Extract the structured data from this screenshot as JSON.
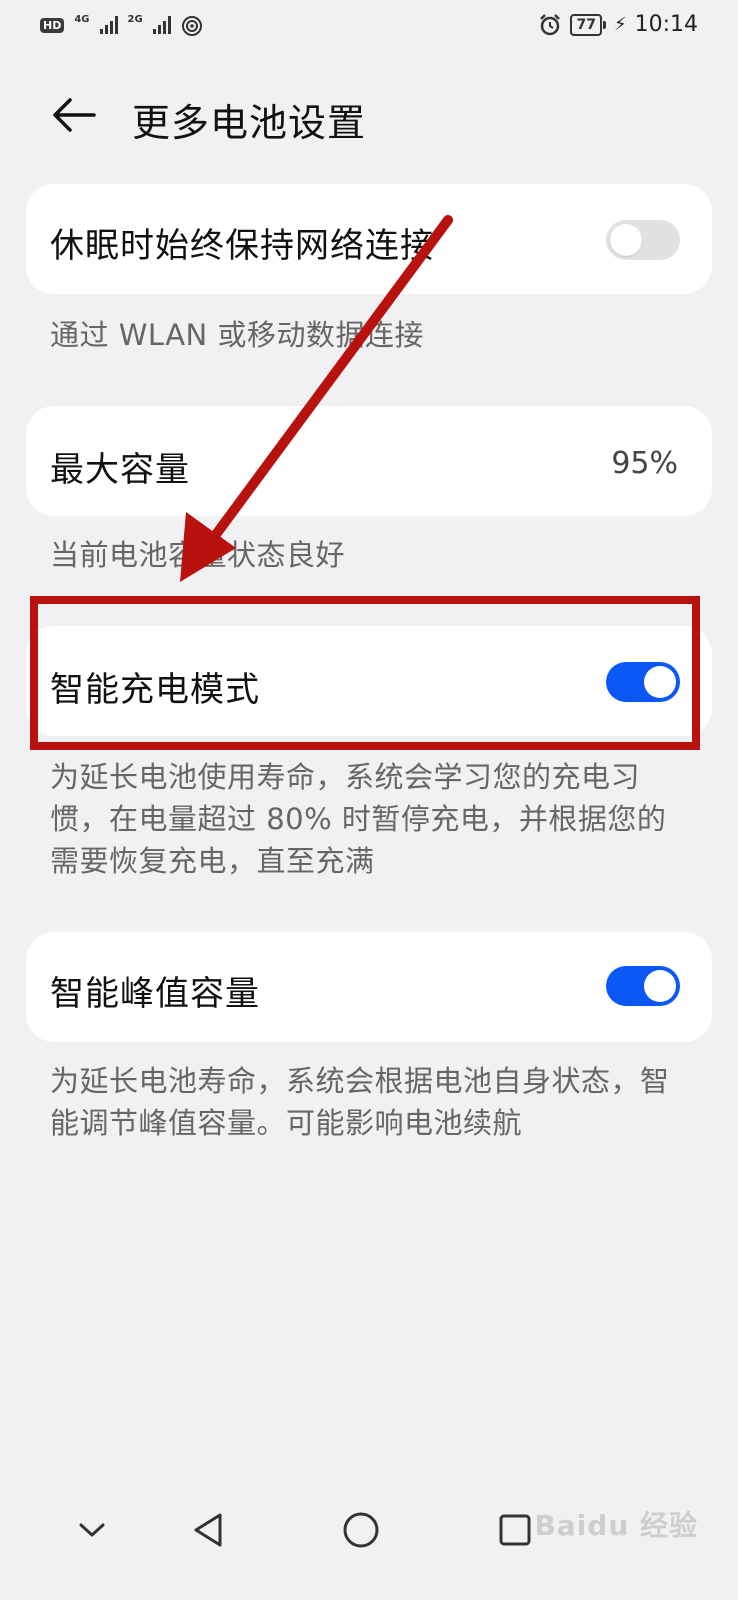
{
  "status_bar": {
    "hd": "HD",
    "sim1_network": "4G",
    "sim2_network": "2G",
    "battery_level": "77",
    "time": "10:14",
    "icons": [
      "hd-icon",
      "signal-icon",
      "wifi-icon",
      "alarm-icon",
      "battery-icon",
      "charging-icon"
    ]
  },
  "header": {
    "title": "更多电池设置",
    "back_icon": "back-arrow-icon"
  },
  "settings": [
    {
      "title": "休眠时始终保持网络连接",
      "description": "通过 WLAN 或移动数据连接",
      "control": "toggle",
      "enabled": false
    },
    {
      "title": "最大容量",
      "value": "95%",
      "description": "当前电池容量状态良好",
      "control": "value"
    },
    {
      "title": "智能充电模式",
      "description": "为延长电池使用寿命，系统会学习您的充电习惯，在电量超过 80% 时暂停充电，并根据您的需要恢复充电，直至充满",
      "control": "toggle",
      "enabled": true
    },
    {
      "title": "智能峰值容量",
      "description": "为延长电池寿命，系统会根据电池自身状态，智能调节峰值容量。可能影响电池续航",
      "control": "toggle",
      "enabled": true
    }
  ],
  "nav_bar": {
    "icons": [
      "collapse-icon",
      "back-triangle-icon",
      "home-circle-icon",
      "recents-square-icon"
    ]
  },
  "annotation": {
    "color": "#b8120f"
  },
  "watermark": "Baidu 经验",
  "colors": {
    "toggle_on": "#0a59f7",
    "toggle_off": "#e2e2e2",
    "background": "#f1f1f3"
  }
}
